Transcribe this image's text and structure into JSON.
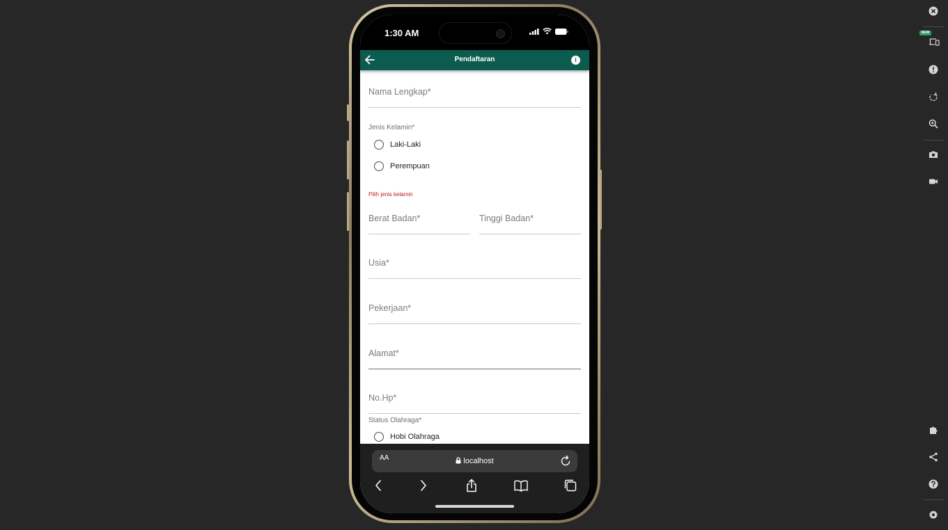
{
  "status_bar": {
    "time": "1:30 AM"
  },
  "app_bar": {
    "title": "Pendaftaran",
    "info_glyph": "i"
  },
  "form": {
    "nama": {
      "placeholder": "Nama Lengkap*"
    },
    "jenis_kelamin": {
      "label": "Jenis Kelamin*",
      "options": [
        "Laki-Laki",
        "Perempuan"
      ],
      "error": "Pilih jenis kelamin"
    },
    "berat": {
      "placeholder": "Berat Badan*"
    },
    "tinggi": {
      "placeholder": "Tinggi Badan*"
    },
    "usia": {
      "placeholder": "Usia*"
    },
    "pekerjaan": {
      "placeholder": "Pekerjaan*"
    },
    "alamat": {
      "placeholder": "Alamat*"
    },
    "nohp": {
      "placeholder": "No.Hp*"
    },
    "status_olahraga": {
      "label": "Status Olahraga*",
      "options": [
        "Hobi Olahraga"
      ]
    }
  },
  "browser": {
    "aa_label": "AA",
    "host": "localhost"
  },
  "devtools": {
    "new_badge": "NEW"
  },
  "colors": {
    "app_bar": "#0c5b4f",
    "error": "#c01c1c",
    "page_bg": "#272727"
  }
}
